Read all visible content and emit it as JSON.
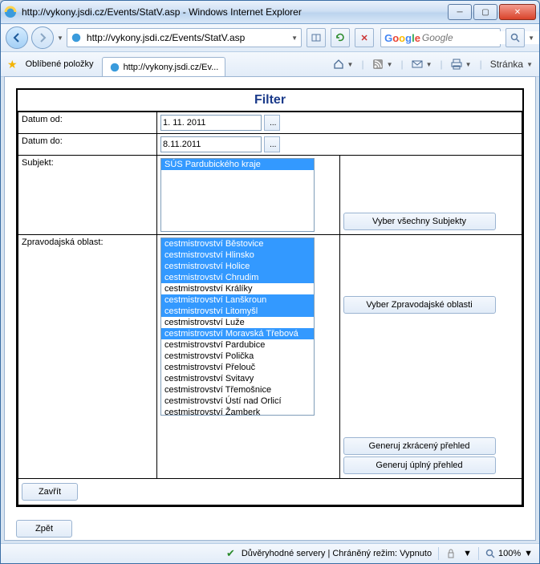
{
  "window": {
    "title": "http://vykony.jsdi.cz/Events/StatV.asp - Windows Internet Explorer"
  },
  "nav": {
    "url": "http://vykony.jsdi.cz/Events/StatV.asp",
    "search_placeholder": "Google"
  },
  "fav": {
    "label": "Oblíbené položky",
    "tab_label": "http://vykony.jsdi.cz/Ev...",
    "page_menu": "Stránka"
  },
  "filter": {
    "title": "Filter",
    "date_from_label": "Datum od:",
    "date_from_value": "1. 11. 2011",
    "date_to_label": "Datum do:",
    "date_to_value": "8.11.2011",
    "subject_label": "Subjekt:",
    "subjects": [
      {
        "text": "SÚS Pardubického kraje",
        "selected": true
      }
    ],
    "select_all_subjects": "Vyber všechny Subjekty",
    "area_label": "Zpravodajská oblast:",
    "areas": [
      {
        "text": "cestmistrovství Běstovice",
        "selected": true
      },
      {
        "text": "cestmistrovství Hlinsko",
        "selected": true
      },
      {
        "text": "cestmistrovství Holice",
        "selected": true
      },
      {
        "text": "cestmistrovství Chrudim",
        "selected": true
      },
      {
        "text": "cestmistrovství Králíky",
        "selected": false
      },
      {
        "text": "cestmistrovství Lanškroun",
        "selected": true
      },
      {
        "text": "cestmistrovství Litomyšl",
        "selected": true
      },
      {
        "text": "cestmistrovství Luže",
        "selected": false
      },
      {
        "text": "cestmistrovství Moravská Třebová",
        "selected": true
      },
      {
        "text": "cestmistrovství Pardubice",
        "selected": false
      },
      {
        "text": "cestmistrovství Polička",
        "selected": false
      },
      {
        "text": "cestmistrovství Přelouč",
        "selected": false
      },
      {
        "text": "cestmistrovství Svitavy",
        "selected": false
      },
      {
        "text": "cestmistrovství Třemošnice",
        "selected": false
      },
      {
        "text": "cestmistrovství Ústí nad Orlicí",
        "selected": false
      },
      {
        "text": "cestmistrovství Žamberk",
        "selected": false
      }
    ],
    "select_areas": "Vyber Zpravodajské oblasti",
    "gen_short": "Generuj zkrácený přehled",
    "gen_full": "Generuj úplný přehled",
    "close": "Zavřít",
    "back": "Zpět"
  },
  "status": {
    "text": "Důvěryhodné servery | Chráněný režim: Vypnuto",
    "zoom": "100%"
  }
}
